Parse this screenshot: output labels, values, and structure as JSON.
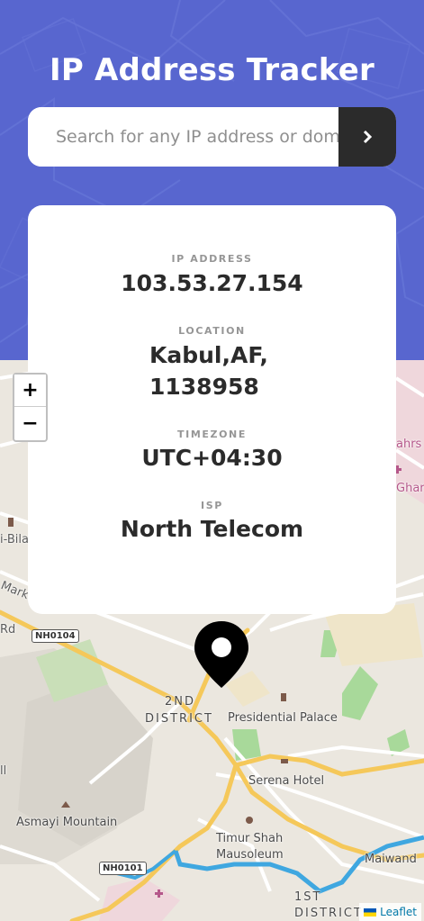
{
  "header": {
    "title": "IP Address Tracker"
  },
  "search": {
    "placeholder": "Search for any IP address or domain",
    "submit_icon": "chevron-right-icon"
  },
  "info": {
    "ip_label": "IP ADDRESS",
    "ip_value": "103.53.27.154",
    "location_label": "LOCATION",
    "location_line1": "Kabul,AF,",
    "location_line2": "1138958",
    "timezone_label": "TIMEZONE",
    "timezone_value": "UTC+04:30",
    "isp_label": "ISP",
    "isp_value": "North Telecom"
  },
  "map": {
    "zoom_in_label": "+",
    "zoom_out_label": "−",
    "marker_icon": "location-pin-icon",
    "labels": {
      "district": "2ND",
      "district2": "DISTRICT",
      "presidential_palace": "Presidential Palace",
      "serena_hotel": "Serena Hotel",
      "asmayi_mountain": "Asmayi Mountain",
      "timur_shah1": "Timur Shah",
      "timur_shah2": "Mausoleum",
      "maiwand": "Maiwand",
      "first_district": "1ST",
      "first_district2": "DISTRICT",
      "nh0104": "NH0104",
      "nh0101": "NH0101",
      "markaz": "Marka",
      "rd": "Rd",
      "bila": "i-Bila",
      "shahrs": "ahrs",
      "ghar": "Ghar",
      "ll": "ll"
    },
    "attribution": "Leaflet"
  },
  "colors": {
    "hero_bg": "#5866cf",
    "dark": "#2b2b2b",
    "road_major": "#f5c85a",
    "river": "#3fa7e0",
    "park": "#a8d99a"
  }
}
